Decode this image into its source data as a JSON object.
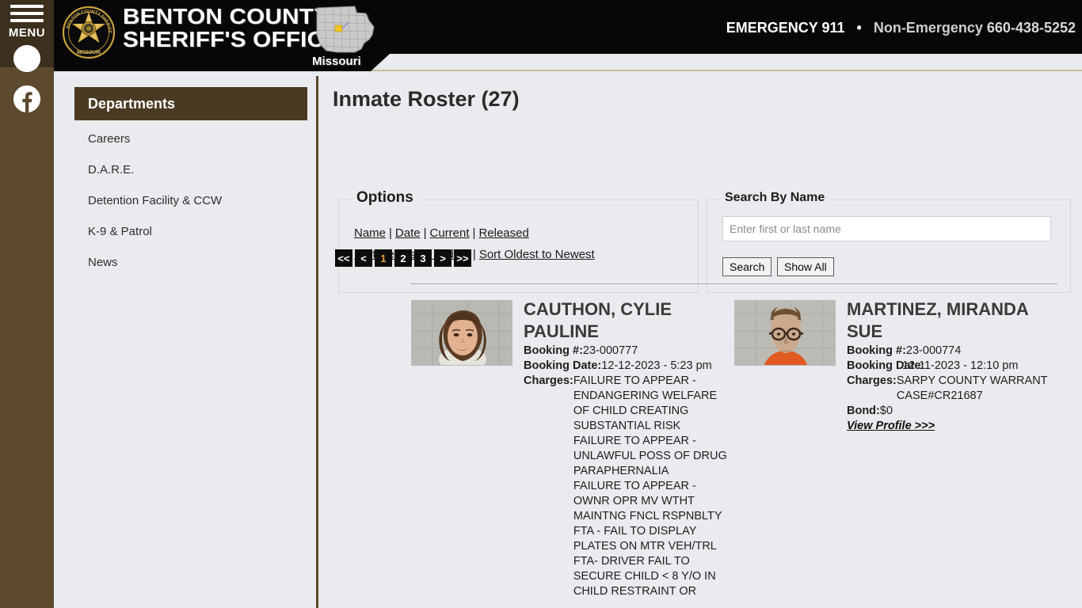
{
  "rail": {
    "menu_label": "MENU",
    "menu_icon": "hamburger-icon",
    "accessibility_icon": "accessibility-icon",
    "facebook_icon": "facebook-icon"
  },
  "header": {
    "badge_icon": "sheriff-star-badge-icon",
    "org_line1": "BENTON COUNTY",
    "org_line2": "SHERIFF'S OFFICE",
    "state_label": "Missouri",
    "state_map_icon": "missouri-map-icon",
    "emergency_label": "EMERGENCY 911",
    "separator": "•",
    "non_emergency_label": "Non-Emergency",
    "non_emergency_number": "660-438-5252",
    "bar_color": "#070707",
    "underline_color": "#c9b99a"
  },
  "sidebar": {
    "header": "Departments",
    "header_bg": "#4b3a22",
    "items": [
      {
        "label": "Careers"
      },
      {
        "label": "D.A.R.E."
      },
      {
        "label": "Detention Facility & CCW"
      },
      {
        "label": "K-9 & Patrol"
      },
      {
        "label": "News"
      }
    ]
  },
  "main": {
    "page_title": "Inmate Roster (27)",
    "options": {
      "legend": "Options",
      "row1": [
        {
          "label": "Name"
        },
        {
          "label": "Date"
        },
        {
          "label": "Current"
        },
        {
          "label": "Released"
        }
      ],
      "row2": [
        {
          "label": "Sort Newest to Oldest"
        },
        {
          "label": "Sort Oldest to Newest"
        }
      ],
      "separator": "|"
    },
    "search": {
      "legend": "Search By Name",
      "placeholder": "Enter first or last name",
      "value": "",
      "search_button": "Search",
      "show_all_button": "Show All"
    },
    "pagination": {
      "items": [
        {
          "label": "<<",
          "active": false
        },
        {
          "label": "<",
          "active": false
        },
        {
          "label": "1",
          "active": true
        },
        {
          "label": "2",
          "active": false
        },
        {
          "label": "3",
          "active": false
        },
        {
          "label": ">",
          "active": false
        },
        {
          "label": ">>",
          "active": false
        }
      ],
      "active_color": "#e8a33d",
      "bg_color": "#0d0d0d"
    },
    "records": [
      {
        "name": "CAUTHON, CYLIE PAULINE",
        "booking_no_label": "Booking #:",
        "booking_no": "23-000777",
        "booking_date_label": "Booking Date:",
        "booking_date": "12-12-2023 - 5:23 pm",
        "charges_label": "Charges:",
        "charges": "FAILURE TO APPEAR - ENDANGERING WELFARE OF CHILD CREATING SUBSTANTIAL RISK\nFAILURE TO APPEAR - UNLAWFUL POSS OF DRUG PARAPHERNALIA\nFAILURE TO APPEAR - OWNR OPR MV WTHT MAINTNG FNCL RSPNBLTY\nFTA - FAIL TO DISPLAY PLATES ON MTR VEH/TRL\nFTA- DRIVER FAIL TO SECURE CHILD < 8 Y/O IN CHILD RESTRAINT OR"
      },
      {
        "name": "MARTINEZ, MIRANDA SUE",
        "booking_no_label": "Booking #:",
        "booking_no": "23-000774",
        "booking_date_label": "Booking Date:",
        "booking_date": "12-11-2023 - 12:10 pm",
        "charges_label": "Charges:",
        "charges": "SARPY COUNTY WARRANT CASE#CR21687",
        "bond_label": "Bond:",
        "bond": "$0",
        "view_profile": "View Profile >>>"
      }
    ]
  }
}
